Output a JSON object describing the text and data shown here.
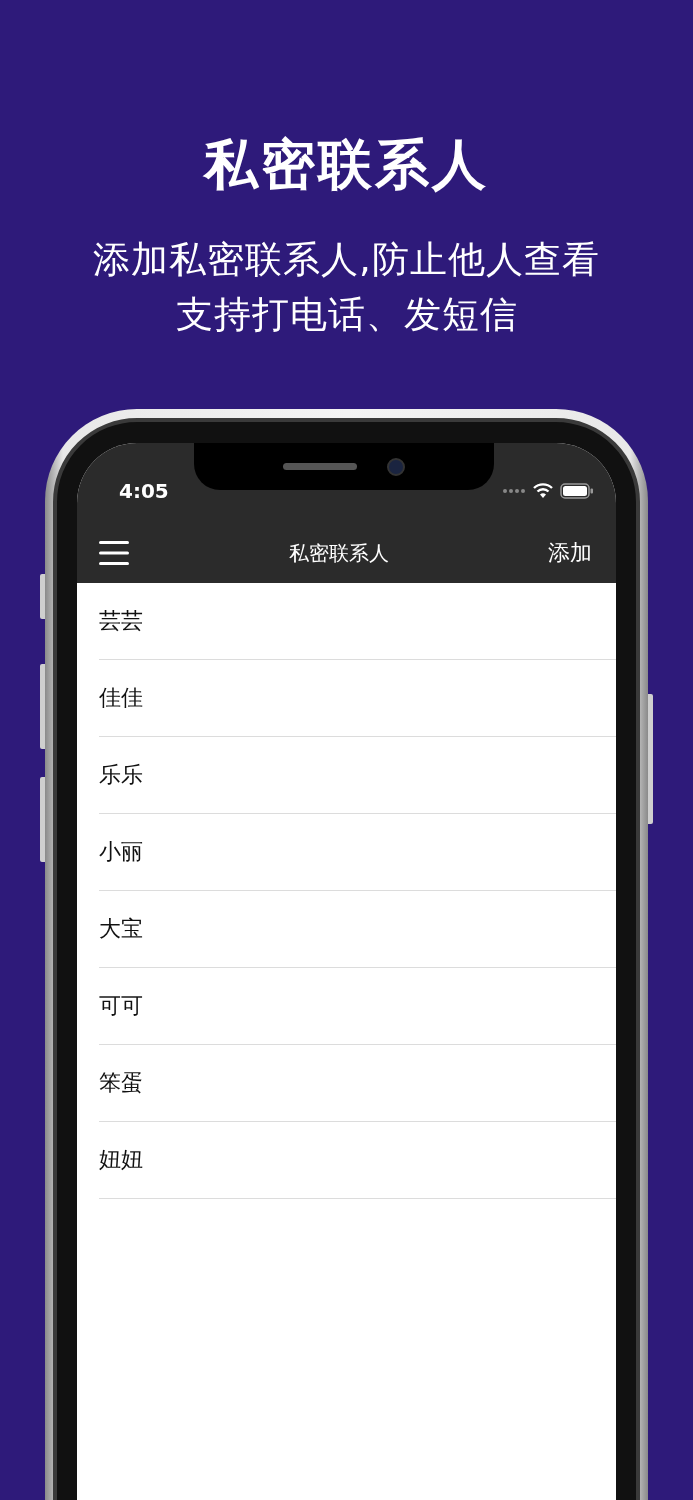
{
  "header": {
    "title": "私密联系人",
    "subtitle_lines": [
      "添加私密联系人,防止他人查看",
      "支持打电话、发短信"
    ]
  },
  "status_bar": {
    "time": "4:05"
  },
  "nav_bar": {
    "title": "私密联系人",
    "action": "添加"
  },
  "contacts": [
    {
      "name": "芸芸"
    },
    {
      "name": "佳佳"
    },
    {
      "name": "乐乐"
    },
    {
      "name": "小丽"
    },
    {
      "name": "大宝"
    },
    {
      "name": "可可"
    },
    {
      "name": "笨蛋"
    },
    {
      "name": "妞妞"
    }
  ]
}
